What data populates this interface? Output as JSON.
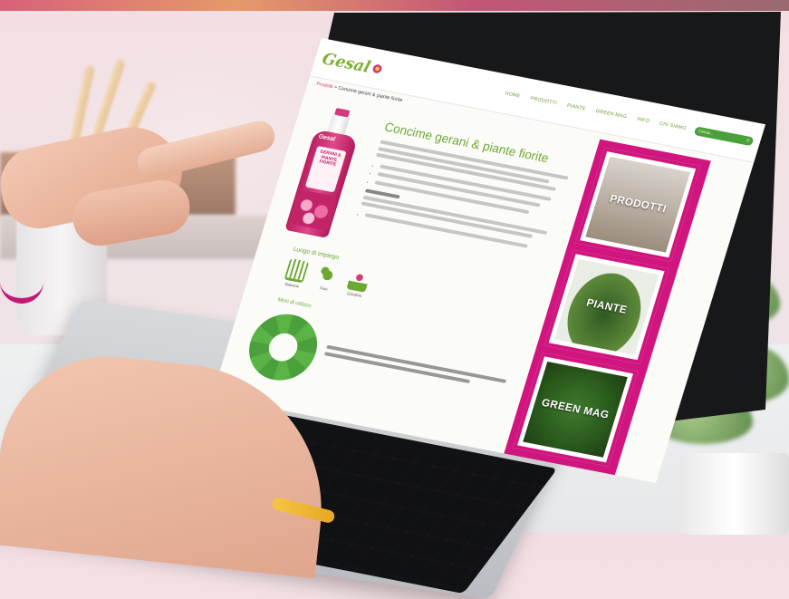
{
  "site": {
    "logo": "Gesal",
    "nav": [
      "HOME",
      "PRODOTTI",
      "PIANTE",
      "GREEN MAG",
      "INFO",
      "CHI SIAMO"
    ],
    "search_placeholder": "Cerca..."
  },
  "breadcrumb": {
    "link": "Prodotti",
    "separator": " > ",
    "current": "Concime gerani & piante fiorite"
  },
  "product": {
    "title": "Concime gerani & piante fiorite",
    "bottle_brand": "Gesal",
    "bottle_label": "GERANI & PIANTE FIORITE"
  },
  "usage": {
    "title": "Luogo di impiego",
    "items": [
      "Balcone",
      "Fiori",
      "Giardino"
    ]
  },
  "months": {
    "title": "Mesi di utilizzo"
  },
  "sidebar": {
    "tiles": [
      "PRODOTTI",
      "PIANTE",
      "GREEN MAG"
    ]
  },
  "colors": {
    "brand_green": "#6da834",
    "accent_magenta": "#d0167e",
    "search_green": "#4aa03a"
  }
}
